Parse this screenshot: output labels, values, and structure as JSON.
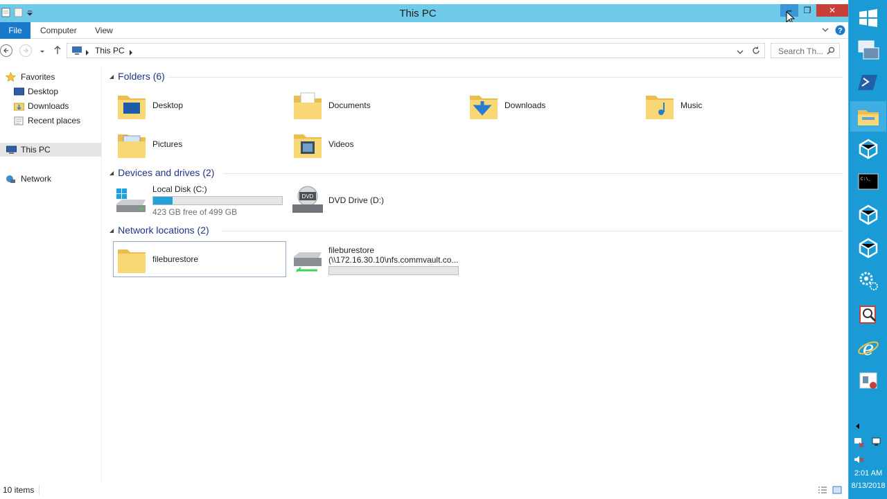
{
  "window": {
    "title": "This PC",
    "controls": {
      "minimize": "‒",
      "restore": "❐",
      "close": "✕"
    }
  },
  "ribbon": {
    "tabs": [
      "File",
      "Computer",
      "View"
    ]
  },
  "address_bar": {
    "crumb": "This PC",
    "search_placeholder": "Search Th..."
  },
  "nav": {
    "favorites": "Favorites",
    "desktop": "Desktop",
    "downloads": "Downloads",
    "recent": "Recent places",
    "this_pc": "This PC",
    "network": "Network"
  },
  "groups": {
    "folders": {
      "header": "Folders (6)",
      "items": [
        "Desktop",
        "Documents",
        "Downloads",
        "Music",
        "Pictures",
        "Videos"
      ]
    },
    "devices": {
      "header": "Devices and drives (2)",
      "local_disk": {
        "name": "Local Disk (C:)",
        "free": "423 GB free of 499 GB",
        "used_fraction": 0.152
      },
      "dvd": {
        "name": "DVD Drive (D:)"
      }
    },
    "network": {
      "header": "Network locations (2)",
      "item1": "fileburestore",
      "item2_name": "fileburestore",
      "item2_path": "(\\\\172.16.30.10\\nfs.commvault.co..."
    }
  },
  "status": {
    "count": "10 items"
  },
  "taskbar": {
    "time": "2:01 AM",
    "date": "8/13/2018"
  },
  "colors": {
    "titlebar": "#6fcaea",
    "file_tab": "#1979ca",
    "taskbar": "#1b9bd6",
    "close": "#c7403a"
  }
}
